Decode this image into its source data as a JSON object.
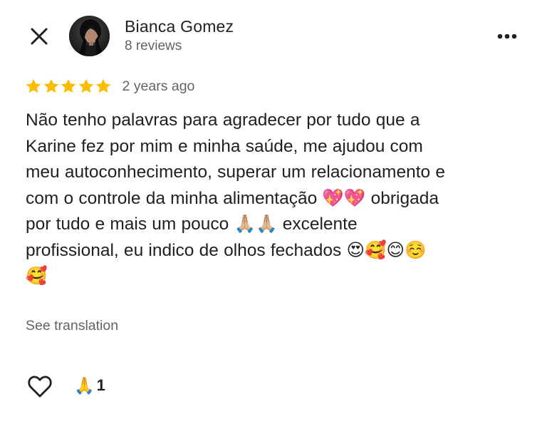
{
  "header": {
    "close_icon": "close-icon",
    "author_name": "Bianca Gomez",
    "author_reviews": "8 reviews",
    "more_icon": "more-horizontal-icon"
  },
  "review": {
    "rating": 5,
    "rating_max": 5,
    "star_color": "#fbbc04",
    "age": "2 years ago",
    "text": "Não tenho palavras para agradecer por tudo que a\nKarine fez por mim e minha saúde, me ajudou com\nmeu autoconhecimento, superar um relacionamento e\ncom o controle da minha alimentação 💖💖 obrigada\npor tudo e mais um pouco 🙏🏼🙏🏼 excelente\nprofissional, eu indico de olhos fechados 😍🥰😊☺️\n🥰",
    "see_translation": "See translation"
  },
  "footer": {
    "like_icon": "heart-outline-icon",
    "reaction_emoji": "🙏",
    "reaction_count": "1"
  }
}
